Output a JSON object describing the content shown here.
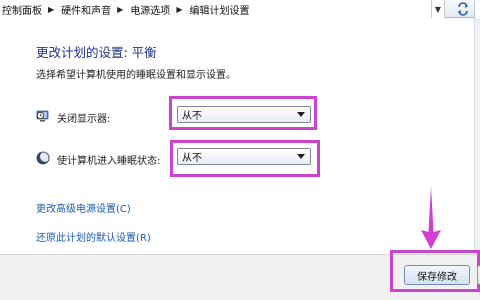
{
  "breadcrumb": {
    "items": [
      "控制面板",
      "硬件和声音",
      "电源选项",
      "编辑计划设置"
    ]
  },
  "page": {
    "title": "更改计划的设置: 平衡",
    "subtitle": "选择希望计算机使用的睡眠设置和显示设置。"
  },
  "settings": {
    "display": {
      "label": "关闭显示器:",
      "value": "从不",
      "icon": "monitor-clock-icon"
    },
    "sleep": {
      "label": "使计算机进入睡眠状态:",
      "value": "从不",
      "icon": "moon-icon"
    }
  },
  "links": {
    "advanced": "更改高级电源设置(C)",
    "restore": "还原此计划的默认设置(R)"
  },
  "buttons": {
    "save": "保存修改"
  },
  "colors": {
    "highlight": "#cc44cc",
    "title": "#1e3287",
    "link": "#1a5bb4"
  }
}
